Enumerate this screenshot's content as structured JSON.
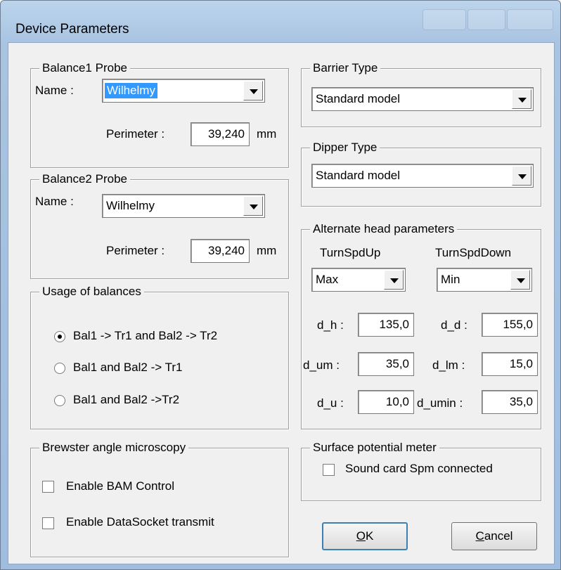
{
  "window": {
    "title": "Device Parameters"
  },
  "balance1": {
    "group_label": "Balance1 Probe",
    "name_label": "Name :",
    "name_value": "Wilhelmy",
    "perimeter_label": "Perimeter :",
    "perimeter_value": "39,240",
    "unit": "mm"
  },
  "balance2": {
    "group_label": "Balance2 Probe",
    "name_label": "Name :",
    "name_value": "Wilhelmy",
    "perimeter_label": "Perimeter :",
    "perimeter_value": "39,240",
    "unit": "mm"
  },
  "usage": {
    "group_label": "Usage of balances",
    "options": [
      {
        "label": "Bal1 -> Tr1 and Bal2 -> Tr2",
        "selected": true
      },
      {
        "label": "Bal1 and Bal2 -> Tr1",
        "selected": false
      },
      {
        "label": "Bal1 and Bal2 ->Tr2",
        "selected": false
      }
    ]
  },
  "barrier": {
    "group_label": "Barrier Type",
    "value": "Standard model"
  },
  "dipper": {
    "group_label": "Dipper Type",
    "value": "Standard model"
  },
  "alternate": {
    "group_label": "Alternate head parameters",
    "turn_up_label": "TurnSpdUp",
    "turn_down_label": "TurnSpdDown",
    "turn_up_value": "Max",
    "turn_down_value": "Min",
    "d_h_label": "d_h :",
    "d_h_value": "135,0",
    "d_d_label": "d_d :",
    "d_d_value": "155,0",
    "d_um_label": "d_um :",
    "d_um_value": "35,0",
    "d_lm_label": "d_lm :",
    "d_lm_value": "15,0",
    "d_u_label": "d_u :",
    "d_u_value": "10,0",
    "d_umin_label": "d_umin :",
    "d_umin_value": "35,0"
  },
  "bam": {
    "group_label": "Brewster angle microscopy",
    "enable_bam_label": "Enable BAM Control",
    "enable_bam_checked": false,
    "datasocket_label": "Enable DataSocket transmit",
    "datasocket_checked": false
  },
  "spm": {
    "group_label": "Surface potential meter",
    "sound_card_label": "Sound card Spm connected",
    "sound_card_checked": false
  },
  "buttons": {
    "ok_mnemonic": "O",
    "ok_rest": "K",
    "cancel_mnemonic": "C",
    "cancel_rest": "ancel"
  }
}
